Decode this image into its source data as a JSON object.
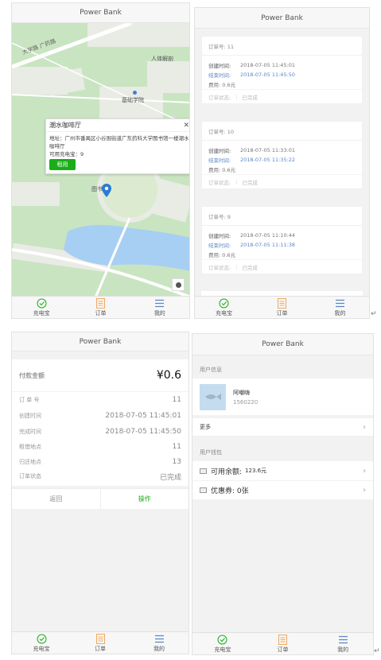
{
  "app_title": "Power Bank",
  "tabs": {
    "charge": "充电宝",
    "orders": "订单",
    "mine": "我的"
  },
  "colors": {
    "green": "#1aad19",
    "orange": "#f0a860",
    "blue": "#5a86c6"
  },
  "map": {
    "labels": {
      "road": "大学路 广药路",
      "building1": "人体解剖",
      "building2": "基础学院",
      "building3": "图书"
    },
    "popup": {
      "title": "潮水咖啡厅",
      "address": "地址：广州市番禺区小谷围街道广东药科大学图书馆一楼潮水咖啡厅",
      "available": "可用充电宝：9",
      "rent_label": "租用",
      "close_icon": "close-icon"
    }
  },
  "orders": [
    {
      "no": "订单号: 11",
      "created_label": "创建时间:",
      "created": "2018-07-05 11:45:01",
      "ended_label": "结束时间:",
      "ended": "2018-07-05 11:45:50",
      "fee": "费用: 0.6元",
      "status_label": "订单状态:",
      "status": "已完成"
    },
    {
      "no": "订单号: 10",
      "created_label": "创建时间:",
      "created": "2018-07-05 11:33:01",
      "ended_label": "结束时间:",
      "ended": "2018-07-05 11:35:22",
      "fee": "费用: 0.6元",
      "status_label": "订单状态:",
      "status": "已完成"
    },
    {
      "no": "订单号: 9",
      "created_label": "创建时间:",
      "created": "2018-07-05 11:10:44",
      "ended_label": "结束时间:",
      "ended": "2018-07-05 11:11:38",
      "fee": "费用: 0.6元",
      "status_label": "订单状态:",
      "status": "已完成"
    }
  ],
  "detail": {
    "amount_label": "付款金额",
    "amount": "¥0.6",
    "rows": [
      {
        "label": "订 单 号",
        "value": "11"
      },
      {
        "label": "创建时间",
        "value": "2018-07-05 11:45:01"
      },
      {
        "label": "完成时间",
        "value": "2018-07-05 11:45:50"
      },
      {
        "label": "租借地点",
        "value": "11"
      },
      {
        "label": "归还地点",
        "value": "13"
      },
      {
        "label": "订单状态",
        "value": "已完成"
      }
    ],
    "back_label": "返回",
    "action_label": "操作"
  },
  "profile": {
    "user_info_label": "用户信息",
    "name": "阿嘲嗨",
    "id": "1560220",
    "more_label": "更多",
    "wallet_label": "用户钱包",
    "balance_label": "可用余额:",
    "balance_value": "123.6元",
    "coupon_label": "优惠券: 0张"
  },
  "return_symbol": "↵"
}
